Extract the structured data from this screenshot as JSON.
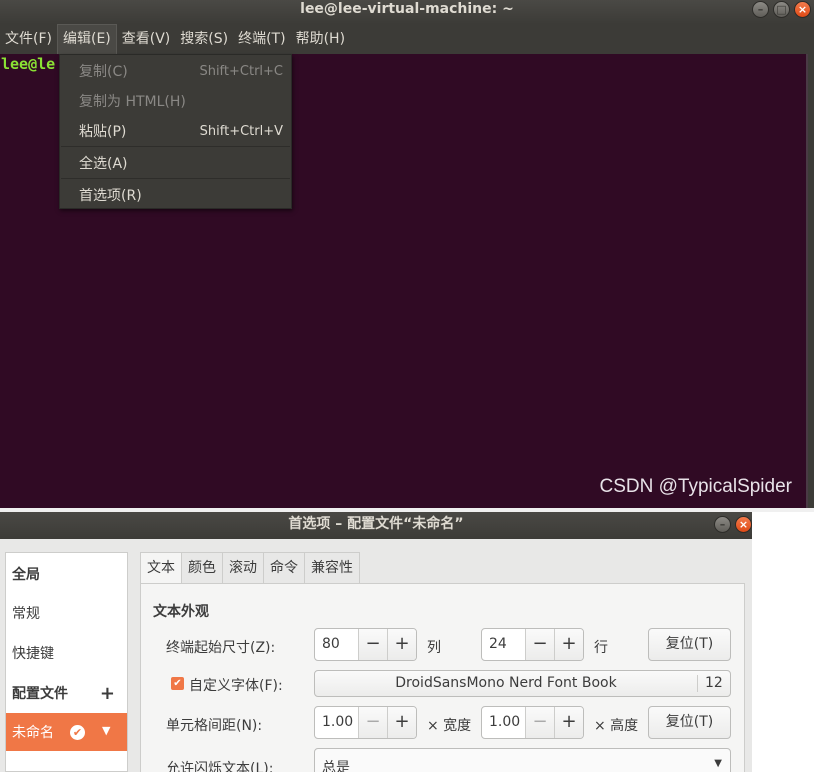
{
  "terminal": {
    "title": "lee@lee-virtual-machine: ~",
    "window_buttons": [
      "minimize-icon",
      "maximize-icon",
      "close-icon"
    ],
    "menus": [
      "文件(F)",
      "编辑(E)",
      "查看(V)",
      "搜索(S)",
      "终端(T)",
      "帮助(H)"
    ],
    "prompt": "lee@le",
    "watermark": "CSDN @TypicalSpider",
    "background": "#300a24"
  },
  "edit_menu": {
    "items": [
      {
        "label": "复制(C)",
        "accel": "Shift+Ctrl+C",
        "enabled": false
      },
      {
        "label": "复制为 HTML(H)",
        "accel": "",
        "enabled": false
      },
      {
        "label": "粘贴(P)",
        "accel": "Shift+Ctrl+V",
        "enabled": true
      },
      {
        "label": "全选(A)",
        "accel": "",
        "enabled": true
      },
      {
        "label": "首选项(R)",
        "accel": "",
        "enabled": true
      }
    ]
  },
  "prefs": {
    "title": "首选项 – 配置文件“未命名”",
    "sidebar": {
      "global_header": "全局",
      "general": "常规",
      "shortcuts": "快捷键",
      "profiles_header": "配置文件",
      "add_symbol": "+",
      "profile_selected": "未命名"
    },
    "tabs": [
      "文本",
      "颜色",
      "滚动",
      "命令",
      "兼容性"
    ],
    "active_tab": "文本",
    "section_title": "文本外观",
    "size_label": "终端起始尺寸(Z):",
    "cols_value": "80",
    "cols_unit": "列",
    "rows_value": "24",
    "rows_unit": "行",
    "reset_label": "复位(T)",
    "custom_font_label": "自定义字体(F):",
    "custom_font_checked": true,
    "font_name": "DroidSansMono Nerd Font Book",
    "font_size": "12",
    "spacing_label": "单元格间距(N):",
    "width_value": "1.00",
    "width_unit": "× 宽度",
    "height_value": "1.00",
    "height_unit": "× 高度",
    "blink_label": "允许闪烁文本(L):",
    "blink_value": "总是",
    "accent": "#f07746"
  }
}
